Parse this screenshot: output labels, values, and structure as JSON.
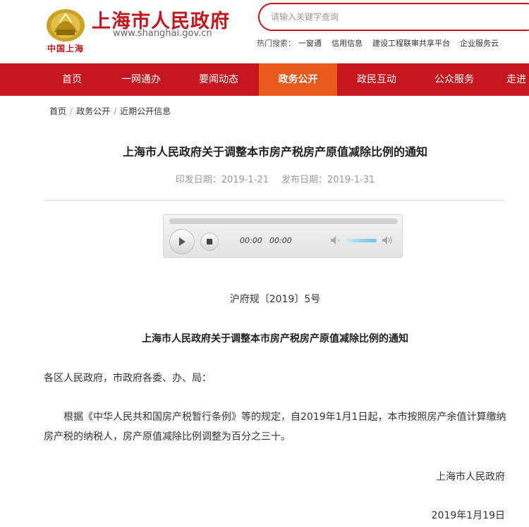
{
  "header": {
    "logo_sub": "中国上海",
    "site_title": "上海市人民政府",
    "site_url": "www.shanghai.gov.cn",
    "search_placeholder": "请输入关键字查询",
    "hot_label": "热门搜索：",
    "hot_items": [
      "一窗通",
      "信用信息",
      "建设工程联审共享平台",
      "企业服务云"
    ]
  },
  "nav": {
    "items": [
      "首页",
      "一网通办",
      "要闻动态",
      "政务公开",
      "政民互动",
      "公众服务",
      "走进"
    ],
    "active": "政务公开"
  },
  "breadcrumb": [
    "首页",
    "政务公开",
    "近期公开信息"
  ],
  "article": {
    "title": "上海市人民政府关于调整本市房产税房产原值减除比例的通知",
    "issue_date_label": "印发日期：2019-1-21",
    "publish_date_label": "发布日期：2019-1-31",
    "player": {
      "elapsed": "00:00",
      "duration": "00:00"
    },
    "doc_number": "沪府规〔2019〕5号",
    "notice_title": "上海市人民政府关于调整本市房产税房产原值减除比例的通知",
    "addressee": "各区人民政府，市政府各委、办、局：",
    "paragraph": "根据《中华人民共和国房产税暂行条例》等的规定，自2019年1月1日起，本市按照房产余值计算缴纳房产税的纳税人，房产原值减除比例调整为百分之三十。",
    "signer": "上海市人民政府",
    "sign_date": "2019年1月19日"
  },
  "colors": {
    "brand_red": "#c4161c",
    "nav_active": "#e85a1c"
  }
}
